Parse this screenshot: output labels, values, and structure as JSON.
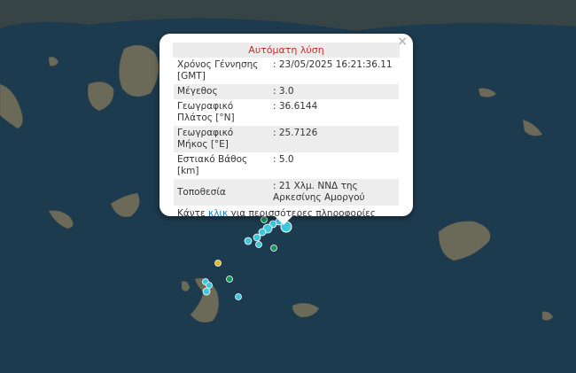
{
  "popup": {
    "title": "Αυτόματη λύση",
    "close_symbol": "×",
    "rows": [
      {
        "label": "Χρόνος Γέννησης [GMT]",
        "value": ": 23/05/2025 16:21:36.11"
      },
      {
        "label": "Μέγεθος",
        "value": ": 3.0"
      },
      {
        "label": "Γεωγραφικό Πλάτος [°N]",
        "value": ": 36.6144"
      },
      {
        "label": "Γεωγραφικό Μήκος [°E]",
        "value": ": 25.7126"
      },
      {
        "label": "Εστιακό Βάθος [km]",
        "value": ": 5.0"
      },
      {
        "label": "Τοποθεσία",
        "value": ": 21 Χλμ. ΝΝΔ της Αρκεσίνης Αμοργού"
      }
    ],
    "more_prefix": "Κάντε",
    "more_link": "κλικ",
    "more_suffix": "για περισσότερες πληροφορίες"
  },
  "colors": {
    "sea": "#1d3b4f",
    "land": "#6b6a58",
    "recent_quake": "#3ec6dd",
    "older_quake": "#1a9660",
    "day_quake": "#e0b82a",
    "title_red": "#d02b2b",
    "link": "#1d7fb8"
  }
}
